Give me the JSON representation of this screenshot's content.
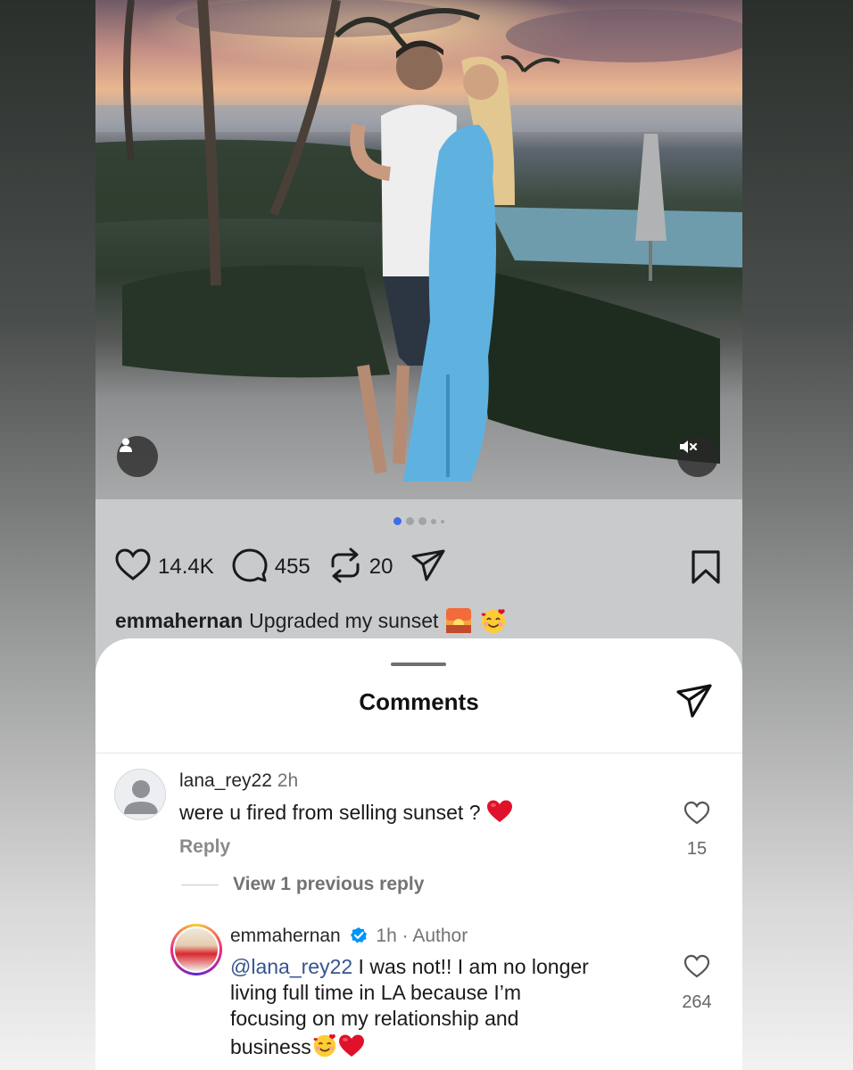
{
  "post": {
    "dots_total": 5,
    "active_dot": 1,
    "likes": "14.4K",
    "comments": "455",
    "reposts": "20",
    "caption_user": "emmahernan",
    "caption_text": "Upgraded my sunset",
    "caption_emojis": [
      "sunset-emoji",
      "smiling-face-with-hearts-emoji"
    ]
  },
  "sheet": {
    "title": "Comments"
  },
  "comments": [
    {
      "user": "lana_rey22",
      "time": "2h",
      "text": "were u fired from selling sunset ?",
      "emoji": "red-heart-emoji",
      "reply_label": "Reply",
      "likes": "15",
      "view_replies": "View 1 previous reply"
    },
    {
      "user": "emmahernan",
      "time": "1h",
      "role": "Author",
      "mention": "@lana_rey22",
      "text_line1": " I was not!! I am no longer",
      "text_line2": "living full time in LA because I’m",
      "text_line3": "focusing on my relationship and",
      "text_line4": "business",
      "emojis": [
        "smiling-face-with-hearts-emoji",
        "red-heart-emoji"
      ],
      "likes": "264"
    }
  ],
  "colors": {
    "accent_blue": "#3f6ee5",
    "mention_blue": "#35558f",
    "verified_blue": "#0095f6",
    "heart_red": "#e0112b"
  }
}
